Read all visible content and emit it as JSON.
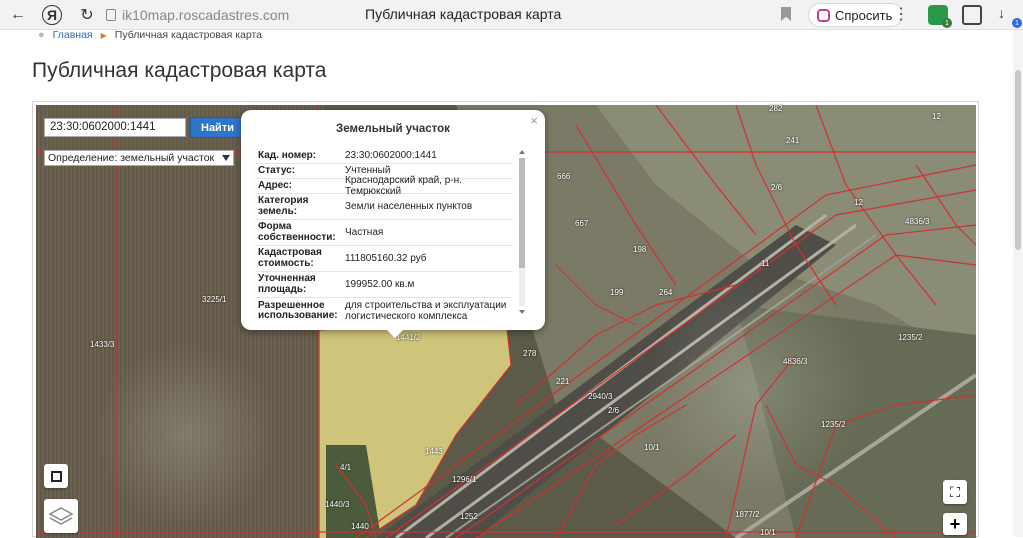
{
  "browser": {
    "url_host": "ik10map.roscadastres.com",
    "tab_title": "Публичная кадастровая карта",
    "ask_label": "Спросить",
    "ext1_badge": "1",
    "ext3_badge": "1"
  },
  "breadcrumb": {
    "home": "Главная",
    "current": "Публичная кадастровая карта"
  },
  "page": {
    "title": "Публичная кадастровая карта"
  },
  "search": {
    "value": "23:30:0602000:1441",
    "button": "Найти",
    "definition": "Определение:  земельный участок"
  },
  "popup": {
    "title": "Земельный участок",
    "close": "×",
    "rows": [
      {
        "k": "Кад. номер:",
        "v": "23:30:0602000:1441"
      },
      {
        "k": "Статус:",
        "v": "Учтенный"
      },
      {
        "k": "Адрес:",
        "v": "Краснодарский край, р-н. Темрюкский"
      },
      {
        "k": "Категория земель:",
        "v": "Земли населенных пунктов"
      },
      {
        "k": "Форма собственности:",
        "v": "Частная"
      },
      {
        "k": "Кадастровая стоимость:",
        "v": "111805160.32 руб"
      },
      {
        "k": "Уточненная площадь:",
        "v": "199952.00 кв.м"
      },
      {
        "k": "Разрешенное использование:",
        "v": "для строительства и эксплуатации логистического комплекса"
      }
    ]
  },
  "map_labels": [
    "282",
    "12",
    "241",
    "2/6",
    "666",
    "12",
    "667",
    "4836/3",
    "198",
    "11",
    "199",
    "264",
    "3225/1",
    "1441/2",
    "278",
    "1433/3",
    "221",
    "4836/3",
    "1235/2",
    "2/6",
    "2940/3",
    "1235/2",
    "10/1",
    "1443",
    "1296/1",
    "4/1",
    "1440",
    "1252",
    "1877/2",
    "10/1",
    "1440/3"
  ],
  "controls": {
    "zoom_in": "+",
    "fullscreen": "⛶"
  }
}
